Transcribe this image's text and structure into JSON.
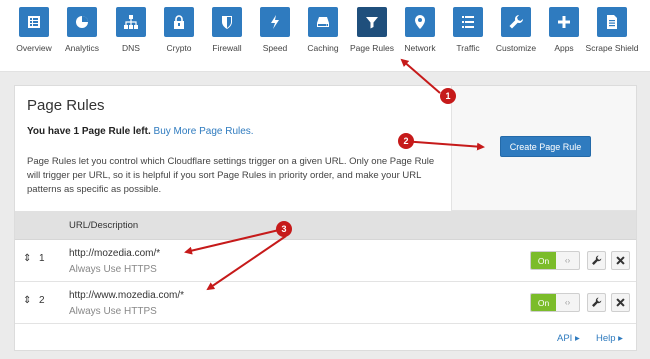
{
  "nav": {
    "items": [
      {
        "label": "Overview",
        "icon": "overview-icon"
      },
      {
        "label": "Analytics",
        "icon": "analytics-icon"
      },
      {
        "label": "DNS",
        "icon": "dns-icon"
      },
      {
        "label": "Crypto",
        "icon": "lock-icon"
      },
      {
        "label": "Firewall",
        "icon": "shield-icon"
      },
      {
        "label": "Speed",
        "icon": "lightning-icon"
      },
      {
        "label": "Caching",
        "icon": "hard-drive-icon"
      },
      {
        "label": "Page Rules",
        "icon": "filter-icon"
      },
      {
        "label": "Network",
        "icon": "location-pin-icon"
      },
      {
        "label": "Traffic",
        "icon": "list-icon"
      },
      {
        "label": "Customize",
        "icon": "wrench-icon"
      },
      {
        "label": "Apps",
        "icon": "plus-icon"
      },
      {
        "label": "Scrape Shield",
        "icon": "document-icon"
      }
    ],
    "active": "Page Rules"
  },
  "page": {
    "title": "Page Rules",
    "rules_left_bold": "You have 1 Page Rule left.",
    "buy_more_link": "Buy More Page Rules.",
    "description": "Page Rules let you control which Cloudflare settings trigger on a given URL. Only one Page Rule will trigger per URL, so it is helpful if you sort Page Rules in priority order, and make your URL patterns as specific as possible.",
    "create_button": "Create Page Rule"
  },
  "table": {
    "header": "URL/Description",
    "rows": [
      {
        "num": "1",
        "url": "http://mozedia.com/*",
        "setting": "Always Use HTTPS",
        "toggle": "On"
      },
      {
        "num": "2",
        "url": "http://www.mozedia.com/*",
        "setting": "Always Use HTTPS",
        "toggle": "On"
      }
    ]
  },
  "footer": {
    "api": "API ▸",
    "help": "Help ▸"
  },
  "annotations": {
    "badges": [
      "1",
      "2",
      "3"
    ],
    "color": "#c61a1a"
  },
  "colors": {
    "primary": "#2f7bbf",
    "active_nav": "#1f4f7c",
    "toggle_on": "#7bbc2a"
  }
}
